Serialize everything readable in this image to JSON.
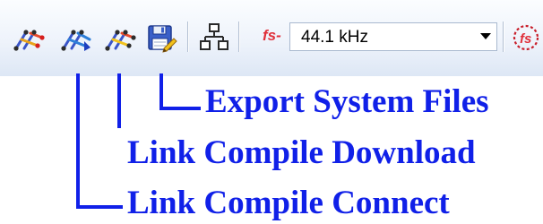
{
  "toolbar": {
    "buttons": [
      {
        "name": "link-compile-connect",
        "icon": "link-compile-connect-icon"
      },
      {
        "name": "link-compile-download",
        "icon": "link-compile-download-icon"
      },
      {
        "name": "link-compile-compile",
        "icon": "link-compile-icon"
      },
      {
        "name": "export-system-files",
        "icon": "save-disk-icon"
      },
      {
        "name": "hierarchy",
        "icon": "hierarchy-icon"
      },
      {
        "name": "fs-settings",
        "icon": "fs-settings-icon"
      }
    ],
    "fs_label": "fs-",
    "sample_rate": {
      "value": "44.1 kHz"
    }
  },
  "callouts": {
    "export": "Export System Files",
    "download": "Link Compile Download",
    "connect": "Link Compile Connect"
  },
  "colors": {
    "callout": "#1020e8",
    "fs_label": "#e0303a",
    "toolbar_top": "#fbfdff",
    "toolbar_bottom": "#dde7f5"
  }
}
